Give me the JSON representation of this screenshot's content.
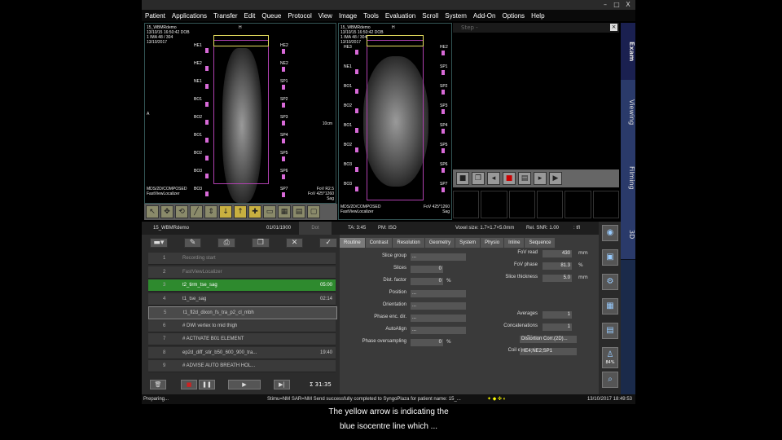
{
  "window": {
    "minimize": "–",
    "maximize": "□",
    "close": "X"
  },
  "menu": [
    "Patient",
    "Applications",
    "Transfer",
    "Edit",
    "Queue",
    "Protocol",
    "View",
    "Image",
    "Tools",
    "Evaluation",
    "Scroll",
    "System",
    "Add-On",
    "Options",
    "Help"
  ],
  "viewer1": {
    "header": "15_WBMRdemo\n13/10/15 16:50:42 DOB\n1 IMA 48 / 304\n13/10/2017",
    "footer": "MDS/2D/COMPOSED\nFastViewLocalizer",
    "right_info": "FoV R2.5\nFoV 425*1260\nSag",
    "scale": "10cm",
    "orient_top": "H",
    "orient_left": "A",
    "labels": [
      "HE1",
      "HE2",
      "NE1",
      "BO1",
      "BO2",
      "BO1",
      "BO2",
      "BO3",
      "BO3"
    ],
    "labels_right": [
      "HE2",
      "NE2",
      "SP1",
      "SP2",
      "SP3",
      "SP4",
      "SP5",
      "SP6",
      "SP7"
    ]
  },
  "viewer2": {
    "header": "15_WBMRdemo\n13/10/15 16:50:42 DOB\n1 IMA 48 / 304\n13/10/2017",
    "footer": "MDS/2D/COMPOSED\nFastViewLocalizer",
    "orient_top": "H",
    "right_info": "FoV 425*1260\nSag",
    "labels": [
      "HE3",
      "NE1",
      "BO1",
      "BO2",
      "BO1",
      "BO2",
      "BO3",
      "BO3"
    ],
    "labels_right": [
      "HE2",
      "SP1",
      "SP2",
      "SP3",
      "SP4",
      "SP5",
      "SP6",
      "SP7"
    ]
  },
  "step_panel": {
    "title": "Step -"
  },
  "side_tabs": [
    "Exam",
    "Viewing",
    "Filming",
    "3D"
  ],
  "info_bar": {
    "patient": "15_WBMRdemo",
    "date": "01/01/1900",
    "dot": "Dot",
    "ta": "TA: 3:45",
    "pm": "PM: ISO",
    "voxel": "Voxel size: 1.7×1.7×5.0mm",
    "snr": "Rel. SNR: 1.00",
    "seq": ": tfl"
  },
  "protocol_list": [
    {
      "n": "1",
      "name": "Recording start",
      "time": "",
      "state": "dim"
    },
    {
      "n": "2",
      "name": "FastViewLocalizer",
      "time": "",
      "state": "dim"
    },
    {
      "n": "3",
      "name": "t2_tirm_tse_sag",
      "time": "05:00",
      "state": "green"
    },
    {
      "n": "4",
      "name": "t1_tse_sag",
      "time": "02:14",
      "state": "normal"
    },
    {
      "n": "5",
      "name": "t1_fl2d_dixon_fs_tra_p2_cl_mbh",
      "time": "",
      "state": "sel"
    },
    {
      "n": "6",
      "name": "# DWI vertex to mid thigh",
      "time": "",
      "state": "normal"
    },
    {
      "n": "7",
      "name": "# ACTIVATE B01 ELEMENT",
      "time": "",
      "state": "normal"
    },
    {
      "n": "8",
      "name": "ep2d_diff_stir_b50_600_900_tra...",
      "time": "19:40",
      "state": "normal"
    },
    {
      "n": "9",
      "name": "# ADVISE AUTO BREATH HOL...",
      "time": "",
      "state": "normal"
    }
  ],
  "total_time": "Σ 31:35",
  "param_tabs": [
    "Routine",
    "Contrast",
    "Resolution",
    "Geometry",
    "System",
    "Physio",
    "Inline",
    "Sequence"
  ],
  "params_left": [
    {
      "label": "Slice group",
      "value": "...",
      "unit": ""
    },
    {
      "label": "Slices",
      "value": "0",
      "unit": ""
    },
    {
      "label": "Dist. factor",
      "value": "0",
      "unit": "%"
    },
    {
      "label": "Position",
      "value": "...",
      "unit": ""
    },
    {
      "label": "Orientation",
      "value": "...",
      "unit": ""
    },
    {
      "label": "Phase enc. dir.",
      "value": "...",
      "unit": ""
    },
    {
      "label": "AutoAlign",
      "value": "...",
      "unit": ""
    },
    {
      "label": "Phase oversampling",
      "value": "0",
      "unit": "%"
    }
  ],
  "params_right": [
    {
      "label": "FoV read",
      "value": "430",
      "unit": "mm"
    },
    {
      "label": "FoV phase",
      "value": "81.3",
      "unit": "%"
    },
    {
      "label": "Slice thickness",
      "value": "5.0",
      "unit": "mm"
    },
    {
      "label": "Averages",
      "value": "1",
      "unit": ""
    },
    {
      "label": "Concatenations",
      "value": "1",
      "unit": ""
    },
    {
      "label": "Filter",
      "value": "Distortion Corr.(2D)...",
      "unit": ""
    },
    {
      "label": "Coil elements",
      "value": "HE4;NE2;SP1",
      "unit": ""
    }
  ],
  "right_icon_pct": "84%",
  "status": {
    "left": "Preparing...",
    "center": "Stimu=NM SAR=NM Send successfully completed to SyngoPlaza for patient name: 15_...",
    "datetime": "13/10/2017 18:49:53"
  },
  "subtitle": [
    "The yellow arrow is indicating the",
    "blue isocentre line which ..."
  ]
}
